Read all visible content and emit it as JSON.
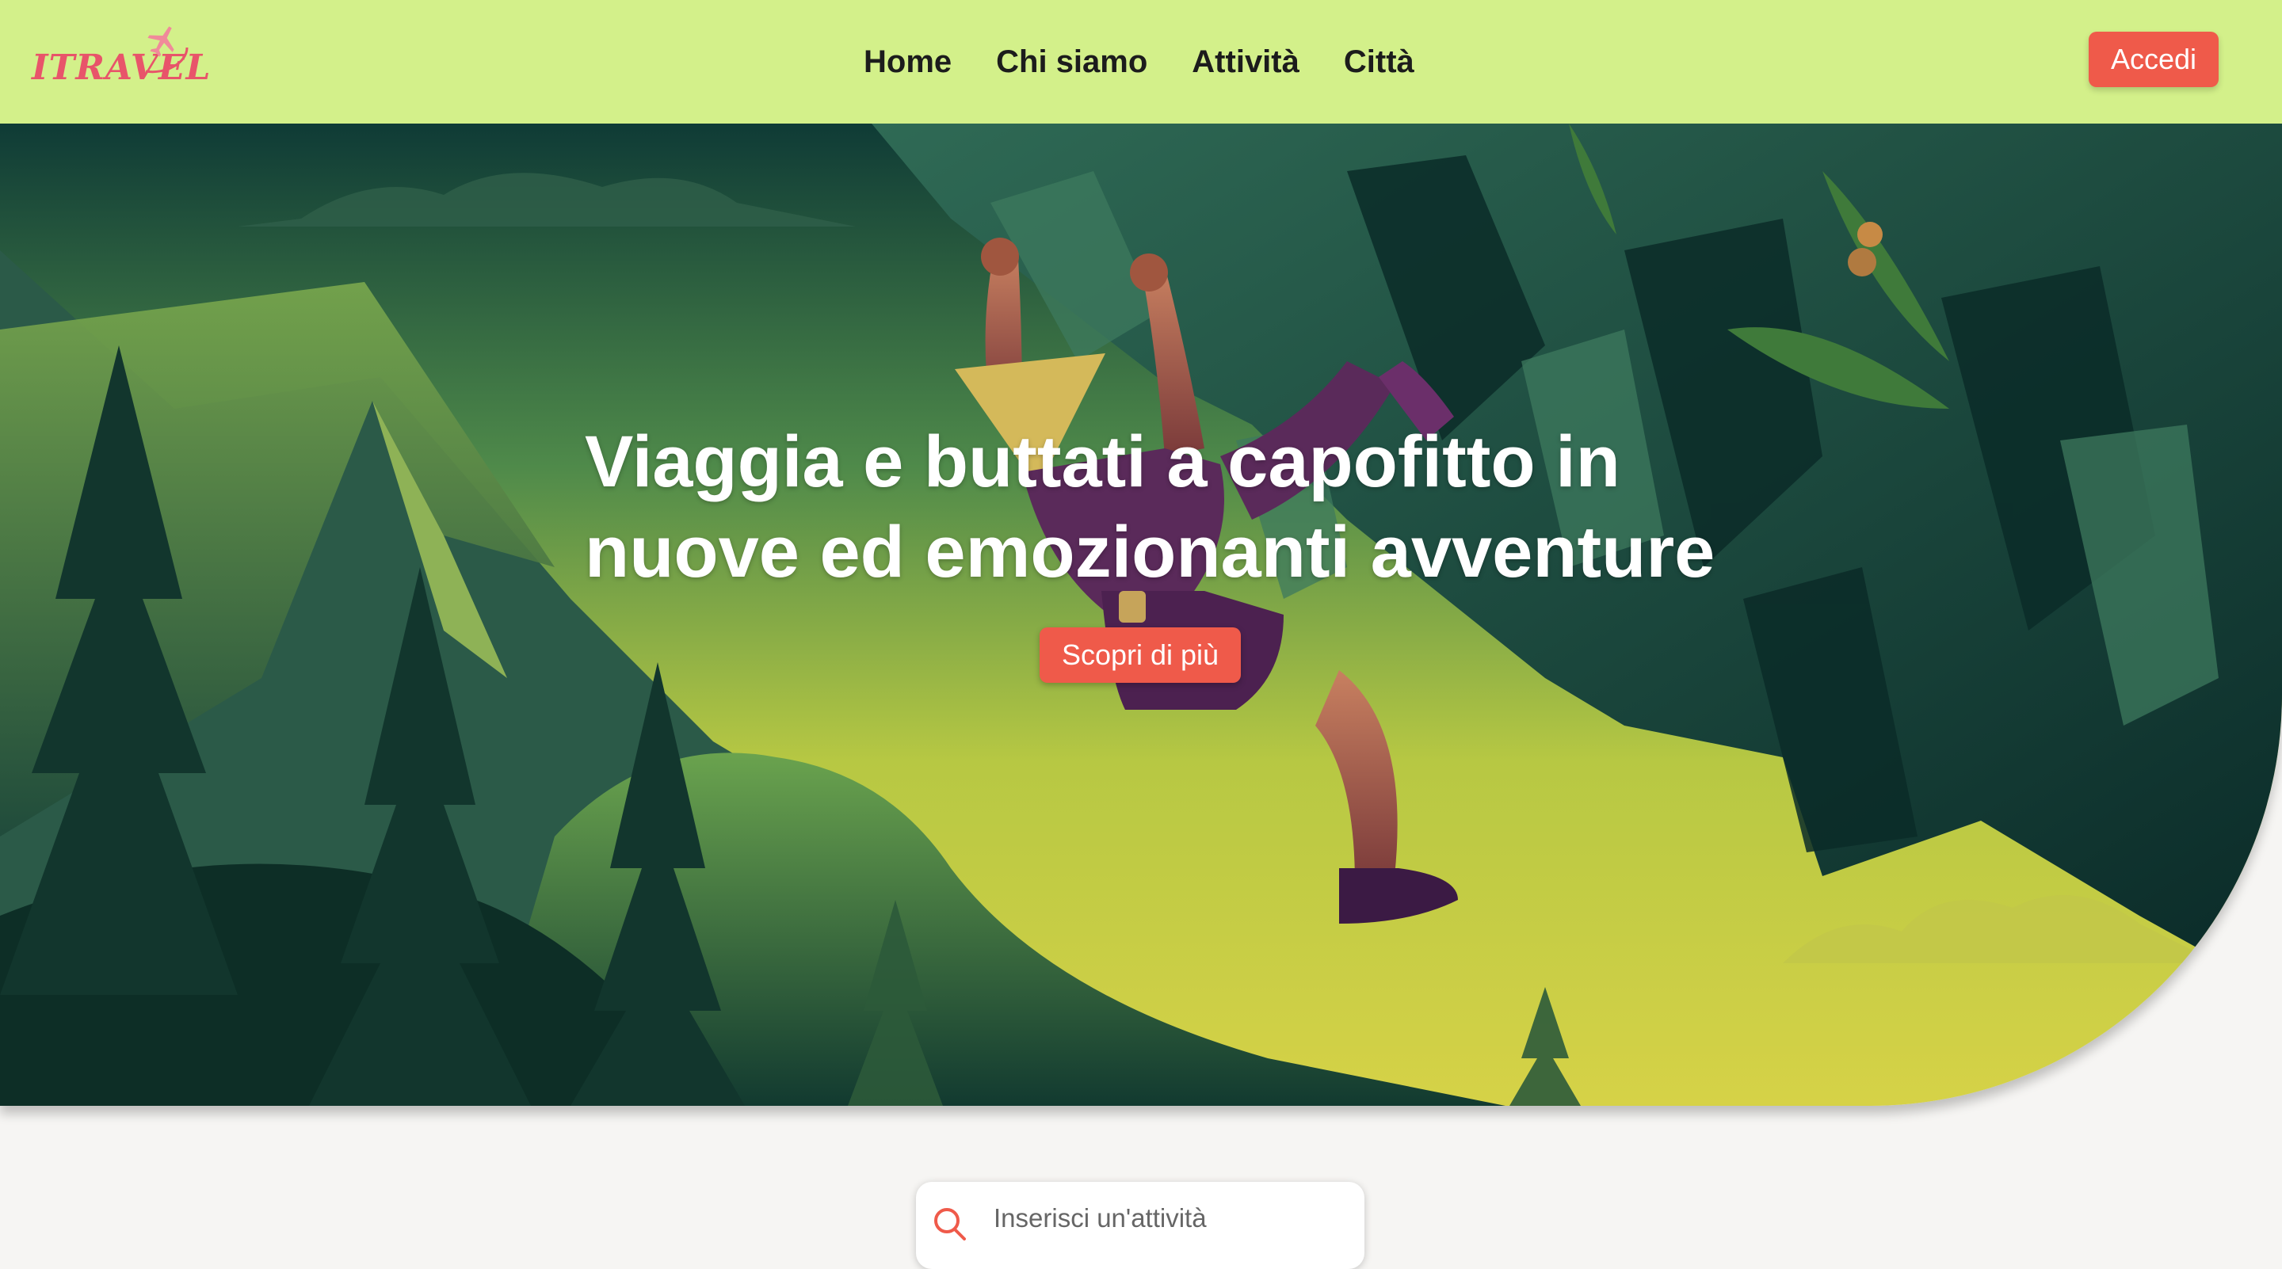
{
  "header": {
    "logo_text": "ITRAVEL",
    "nav": [
      {
        "label": "Home"
      },
      {
        "label": "Chi siamo"
      },
      {
        "label": "Attività"
      },
      {
        "label": "Città"
      }
    ],
    "login_label": "Accedi"
  },
  "hero": {
    "title_line1": "Viaggia e buttati a capofitto in",
    "title_line2": "nuove ed emozionanti avventure",
    "cta_label": "Scopri di più"
  },
  "search": {
    "placeholder": "Inserisci un'attività",
    "value": ""
  },
  "colors": {
    "navbar_bg": "#d3f08a",
    "accent": "#ef5a4a",
    "logo": "#e8546a",
    "page_bg": "#f6f5f3"
  },
  "icons": {
    "logo": "airplane-icon",
    "search": "search-icon"
  }
}
